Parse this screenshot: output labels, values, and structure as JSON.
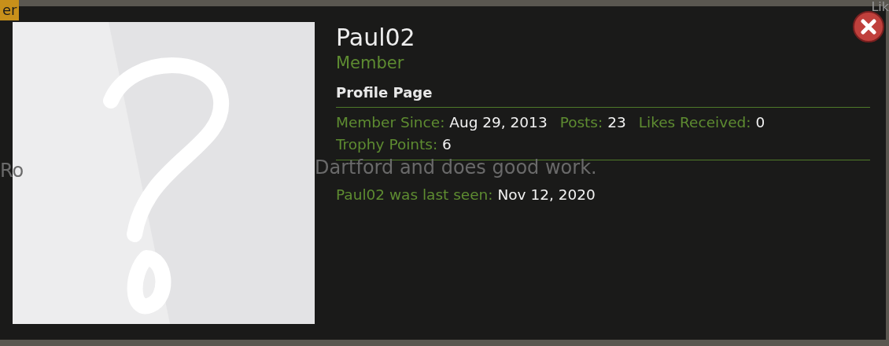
{
  "background_page": {
    "tag": "er",
    "side_text": "Lik",
    "sentence_start": "Ro",
    "sentence_end": "Dartford and does good work."
  },
  "member_card": {
    "username": "Paul02",
    "title": "Member",
    "profile_link": "Profile Page",
    "stats": [
      {
        "label": "Member Since:",
        "value": "Aug 29, 2013"
      },
      {
        "label": "Posts:",
        "value": "23"
      },
      {
        "label": "Likes Received:",
        "value": "0"
      },
      {
        "label": "Trophy Points:",
        "value": "6"
      }
    ],
    "last_seen": {
      "label": "Paul02 was last seen:",
      "value": "Nov 12, 2020"
    }
  }
}
